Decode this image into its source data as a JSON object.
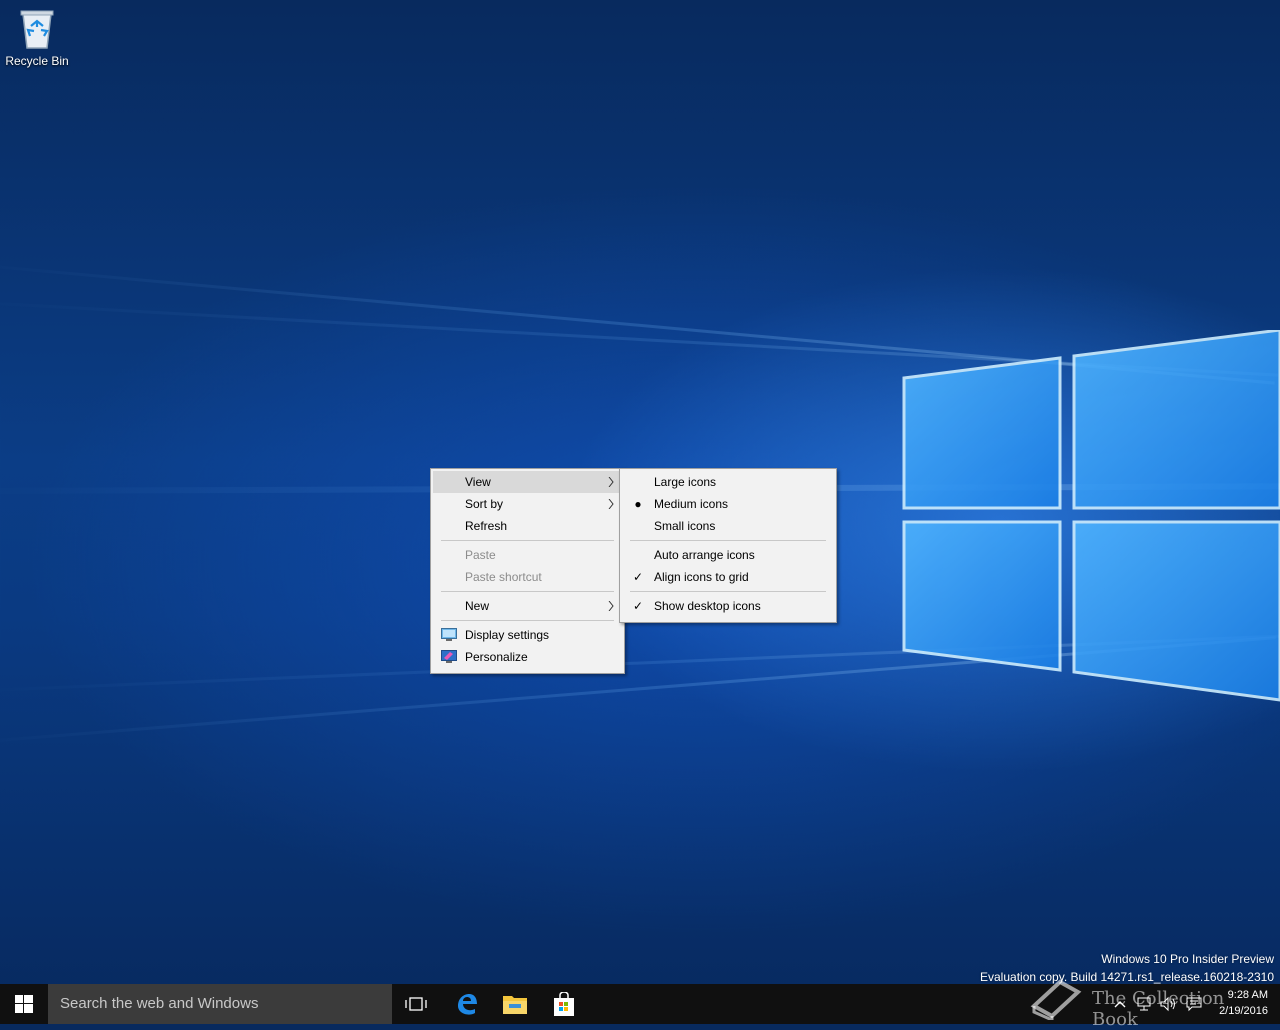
{
  "desktop": {
    "recycle_bin_label": "Recycle Bin"
  },
  "context_menu": {
    "items": [
      {
        "label": "View"
      },
      {
        "label": "Sort by"
      },
      {
        "label": "Refresh"
      },
      {
        "label": "Paste"
      },
      {
        "label": "Paste shortcut"
      },
      {
        "label": "New"
      },
      {
        "label": "Display settings"
      },
      {
        "label": "Personalize"
      }
    ]
  },
  "view_submenu": {
    "items": [
      {
        "label": "Large icons"
      },
      {
        "label": "Medium icons",
        "state": "selected"
      },
      {
        "label": "Small icons"
      },
      {
        "label": "Auto arrange icons"
      },
      {
        "label": "Align icons to grid",
        "state": "checked"
      },
      {
        "label": "Show desktop icons",
        "state": "checked"
      }
    ]
  },
  "watermark": {
    "line1": "Windows 10 Pro Insider Preview",
    "line2": "Evaluation copy. Build 14271.rs1_release.160218-2310",
    "brand": "The Collection Book"
  },
  "taskbar": {
    "search_placeholder": "Search the web and Windows",
    "time": "9:28 AM",
    "date": "2/19/2016"
  },
  "colors": {
    "taskbar": "#101010",
    "search_box": "#3b3b3b",
    "menu_bg": "#f2f2f2",
    "menu_highlight": "#d9d9d9",
    "edge_blue": "#1e88e5",
    "folder_yellow": "#f3c53c"
  }
}
